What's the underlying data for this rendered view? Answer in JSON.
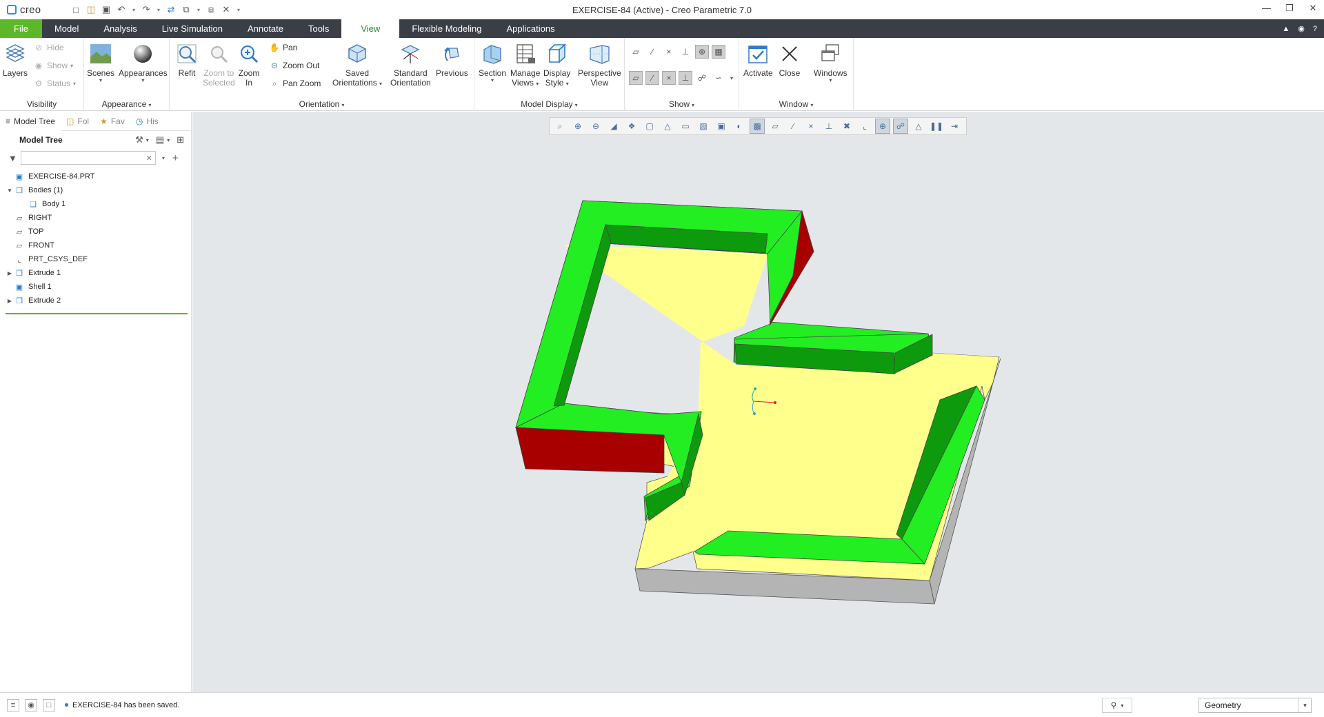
{
  "app": {
    "logo_text": "creo",
    "window_title": "EXERCISE-84 (Active) - Creo Parametric 7.0"
  },
  "tabs": [
    {
      "label": "File"
    },
    {
      "label": "Model"
    },
    {
      "label": "Analysis"
    },
    {
      "label": "Live Simulation"
    },
    {
      "label": "Annotate"
    },
    {
      "label": "Tools"
    },
    {
      "label": "View"
    },
    {
      "label": "Flexible Modeling"
    },
    {
      "label": "Applications"
    }
  ],
  "active_tab": "View",
  "ribbon": {
    "visibility": {
      "title": "Visibility",
      "layers": "Layers",
      "hide": "Hide",
      "show": "Show",
      "status": "Status"
    },
    "appearance": {
      "title": "Appearance",
      "scenes": "Scenes",
      "appearances": "Appearances"
    },
    "orientation": {
      "title": "Orientation",
      "refit": "Refit",
      "zoom_to_selected_1": "Zoom to",
      "zoom_to_selected_2": "Selected",
      "zoom_in_1": "Zoom",
      "zoom_in_2": "In",
      "pan": "Pan",
      "zoom_out": "Zoom Out",
      "pan_zoom": "Pan Zoom",
      "saved_1": "Saved",
      "saved_2": "Orientations",
      "standard_1": "Standard",
      "standard_2": "Orientation",
      "previous": "Previous"
    },
    "model_display": {
      "title": "Model Display",
      "section": "Section",
      "manage_1": "Manage",
      "manage_2": "Views",
      "display_1": "Display",
      "display_2": "Style",
      "perspective_1": "Perspective",
      "perspective_2": "View"
    },
    "show": {
      "title": "Show"
    },
    "window": {
      "title": "Window",
      "activate": "Activate",
      "close": "Close",
      "windows": "Windows"
    }
  },
  "nav_tabs": [
    {
      "label": "Model Tree"
    },
    {
      "label": "Fol"
    },
    {
      "label": "Fav"
    },
    {
      "label": "His"
    }
  ],
  "model_tree": {
    "header": "Model Tree",
    "search_placeholder": "",
    "items": [
      {
        "label": "EXERCISE-84.PRT",
        "icon": "part-icon"
      },
      {
        "label": "Bodies (1)",
        "icon": "bodies-icon"
      },
      {
        "label": "Body 1",
        "icon": "body-icon"
      },
      {
        "label": "RIGHT",
        "icon": "datum-plane-icon"
      },
      {
        "label": "TOP",
        "icon": "datum-plane-icon"
      },
      {
        "label": "FRONT",
        "icon": "datum-plane-icon"
      },
      {
        "label": "PRT_CSYS_DEF",
        "icon": "csys-icon"
      },
      {
        "label": "Extrude 1",
        "icon": "extrude-icon"
      },
      {
        "label": "Shell 1",
        "icon": "shell-icon"
      },
      {
        "label": "Extrude 2",
        "icon": "extrude-icon"
      }
    ]
  },
  "status": {
    "message": "EXERCISE-84 has been saved.",
    "selection_filter": "Geometry"
  },
  "colors": {
    "file_tab": "#5cb829",
    "tab_bar": "#3a3f45",
    "active_tab_text": "#2a8a2a",
    "model_top_face": "#ffff8c",
    "model_wall_top": "#22ee22",
    "model_wall_inner": "#0d9a0d",
    "model_red_face": "#a80000",
    "model_side_gray": "#b4b4b4"
  }
}
